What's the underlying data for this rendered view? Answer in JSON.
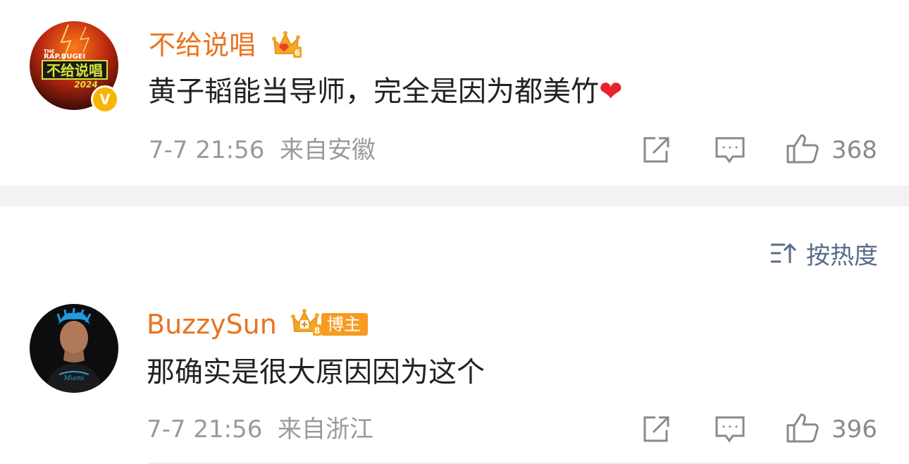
{
  "comments": [
    {
      "username": "不给说唱",
      "text": "黄子韬能当导师，完全是因为都美竹",
      "heart": "❤",
      "time": "7-7 21:56",
      "location": "来自安徽",
      "likes": "368",
      "avatar_text": {
        "the": "THE",
        "rap": "RAP.BUGEI",
        "title": "不给说唱",
        "year": "2024"
      },
      "verified_mark": "V",
      "crown_level": "6"
    },
    {
      "username": "BuzzySun",
      "text": "那确实是很大原因因为这个",
      "time": "7-7 21:56",
      "location": "来自浙江",
      "likes": "396",
      "badge": "博主",
      "crown_level": "8"
    }
  ],
  "sort": {
    "label": "按热度"
  },
  "colors": {
    "username": "#e8741f",
    "text": "#222222",
    "meta": "#9a9a9a",
    "sort": "#586c88",
    "heart": "#e8222b",
    "separator": "#f2f2f2"
  },
  "icons": [
    "share-icon",
    "comment-icon",
    "like-icon",
    "sort-icon",
    "crown-icon",
    "verified-icon"
  ]
}
